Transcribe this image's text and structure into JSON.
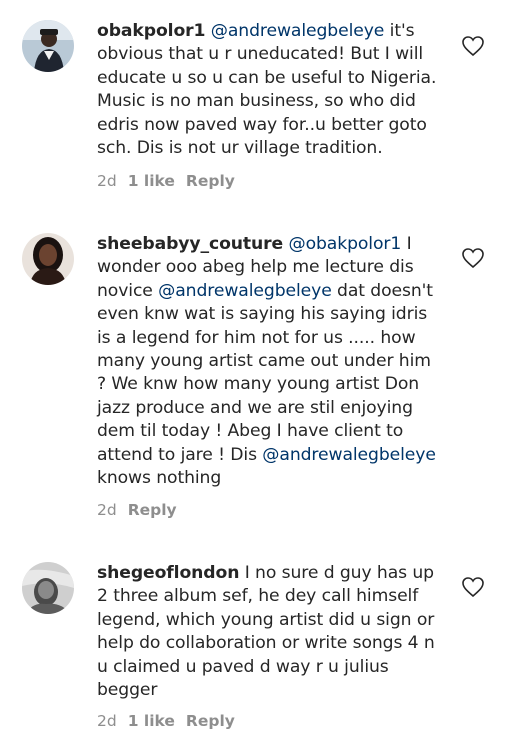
{
  "comments": [
    {
      "username": "obakpolor1",
      "mention": "@andrewalegbeleye",
      "text": " it's obvious that u r uneducated! But I will educate u so u can be useful to Nigeria. Music is no man business, so who did edris now paved way for..u better goto sch. Dis is not ur village tradition.",
      "time": "2d",
      "likes": "1 like",
      "reply": "Reply"
    },
    {
      "username": "sheebabyy_couture",
      "mention": "@obakpolor1",
      "text_a": " I wonder ooo abeg help me lecture dis novice ",
      "mention2": "@andrewalegbeleye",
      "text_b": " dat doesn't even knw wat is saying his saying idris is a legend for him not for us ..... how many young artist came out under him ? We knw how many young artist Don jazz produce and we are stil enjoying dem til today ! Abeg I have client to attend to jare ! Dis ",
      "mention3": "@andrewalegbeleye",
      "text_c": " knows nothing",
      "time": "2d",
      "reply": "Reply"
    },
    {
      "username": "shegeoflondon",
      "text": " I no sure d guy has up 2 three album sef, he dey call himself legend, which young artist did u sign or help do collaboration or write songs 4 n u claimed u paved d way r u julius begger",
      "time": "2d",
      "likes": "1 like",
      "reply": "Reply"
    }
  ],
  "icons": {
    "like": "heart-outline-icon"
  },
  "colors": {
    "text": "#262626",
    "mention": "#003569",
    "meta": "#8e8e8e"
  }
}
